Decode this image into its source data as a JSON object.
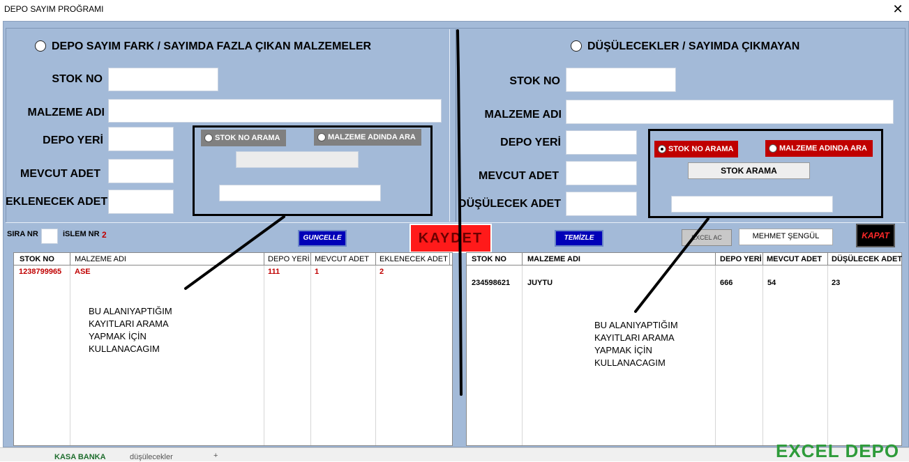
{
  "window": {
    "title": "DEPO SAYIM PROĞRAMI",
    "close": "✕"
  },
  "left_panel": {
    "header": "DEPO SAYIM FARK  /  SAYIMDA FAZLA ÇIKAN MALZEMELER",
    "labels": {
      "stok_no": "STOK NO",
      "malzeme_adi": "MALZEME ADI",
      "depo_yeri": "DEPO YERİ",
      "mevcut_adet": "MEVCUT ADET",
      "eklenecek_adet": "EKLENECEK ADET"
    },
    "search": {
      "opt_stok": "STOK NO ARAMA",
      "opt_malzeme": "MALZEME ADINDA ARA"
    }
  },
  "right_panel": {
    "header": "DÜŞÜLECEKLER  /  SAYIMDA ÇIKMAYAN",
    "labels": {
      "stok_no": "STOK NO",
      "malzeme_adi": "MALZEME ADI",
      "depo_yeri": "DEPO YERİ",
      "mevcut_adet": "MEVCUT ADET",
      "dusulecek_adet": "DÜŞÜLECEK ADET"
    },
    "search": {
      "opt_stok": "STOK NO ARAMA",
      "opt_malzeme": "MALZEME ADINDA ARA",
      "button": "STOK ARAMA"
    }
  },
  "toolbar": {
    "sira_nr": "SIRA NR",
    "islem_nr": "iSLEM NR",
    "islem_nr_value": "2",
    "guncelle": "GUNCELLE",
    "kaydet": "KAYDET",
    "temizle": "TEMİZLE",
    "excel": "EXCEL AC",
    "user": "MEHMET ŞENGÜL",
    "kapat": "KAPAT"
  },
  "left_table": {
    "columns": [
      "STOK NO",
      "MALZEME ADI",
      "DEPO YERİ",
      "MEVCUT ADET",
      "EKLENECEK ADET"
    ],
    "rows": [
      {
        "stok_no": "1238799965",
        "malzeme_adi": "ASE",
        "depo_yeri": "111",
        "mevcut_adet": "1",
        "eklenecek_adet": "2"
      }
    ]
  },
  "right_table": {
    "columns": [
      "STOK NO",
      "MALZEME ADI",
      "DEPO YERİ",
      "MEVCUT ADET",
      "DÜŞÜLECEK ADET"
    ],
    "rows": [
      {
        "stok_no": "234598621",
        "malzeme_adi": "JUYTU",
        "depo_yeri": "666",
        "mevcut_adet": "54",
        "dusulecek_adet": "23"
      }
    ]
  },
  "annotations": {
    "left_note": [
      "BU ALANIYAPTIĞIM",
      "KAYITLARI  ARAMA",
      "YAPMAK İÇİN",
      "KULLANACAGIM"
    ],
    "right_note": [
      "BU ALANIYAPTIĞIM",
      "KAYITLARI  ARAMA",
      "YAPMAK İÇİN",
      "KULLANACAGIM"
    ]
  },
  "footer": {
    "tab1": "KASA BANKA",
    "tab2": "düşülecekler",
    "tab3": "+",
    "watermark": "EXCEL DEPO"
  },
  "colors": {
    "panel_bg": "#a3bad8",
    "accent_red": "#c00000",
    "button_blue": "#0000b8"
  }
}
